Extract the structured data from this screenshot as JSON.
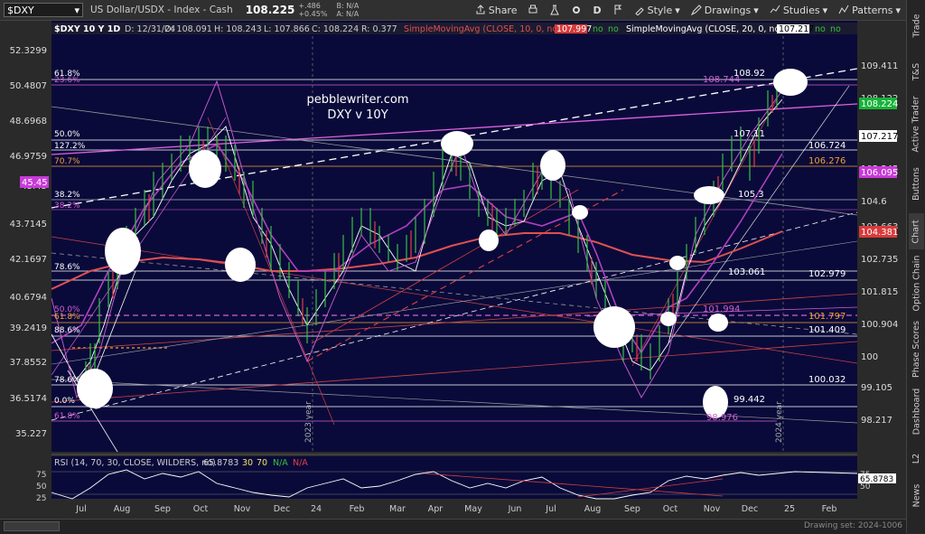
{
  "toolbar": {
    "symbol": "$DXY",
    "description": "US Dollar/USDX - Index - Cash",
    "price": "108.225",
    "change": "+.486",
    "change_pct": "+0.45%",
    "bid": "B: N/A",
    "ask": "A: N/A",
    "share": "Share",
    "period": "D",
    "style": "Style",
    "drawings": "Drawings",
    "studies": "Studies",
    "patterns": "Patterns"
  },
  "info": {
    "title": "$DXY 10 Y 1D",
    "date": "D: 12/31/24",
    "open": "O: 108.091",
    "high": "H: 108.243",
    "low": "L: 107.866",
    "close": "C: 108.224",
    "range": "R: 0.377",
    "sma10": "SimpleMovingAvg (CLOSE, 10, 0, no)",
    "sma10_val": "107.997",
    "sma20": "SimpleMovingAvg (CLOSE, 20, 0, no)",
    "sma20_val": "107.217",
    "no": "no"
  },
  "watermark": {
    "line1": "pebblewriter.com",
    "line2": "DXY v 10Y"
  },
  "price_axis": [
    "52.3299",
    "50.4807",
    "48.6968",
    "46.9759",
    "45.45",
    "43.7145",
    "42.1697",
    "40.6794",
    "39.2419",
    "37.8552",
    "36.5174",
    "35.227"
  ],
  "right_axis": [
    "109.411",
    "108.122",
    "106.499",
    "105.545",
    "104.6",
    "103.663",
    "102.735",
    "101.815",
    "100.904",
    "100",
    "99.105",
    "98.217"
  ],
  "tags": [
    {
      "t": "108.224",
      "c": "#17b33a",
      "fg": "#fff"
    },
    {
      "t": "107.217",
      "c": "#ffffff",
      "fg": "#000"
    },
    {
      "t": "106.095",
      "c": "#c83ad8",
      "fg": "#fff"
    },
    {
      "t": "104.381",
      "c": "#d93a3a",
      "fg": "#fff"
    },
    {
      "t": "45.45",
      "c": "#c83ad8",
      "fg": "#fff"
    }
  ],
  "fib_left": [
    "61.8%",
    "23.6%",
    "50.0%",
    "127.2%",
    "70.7%",
    "38.2%",
    "38.2%",
    "78.6%",
    "50.0%",
    "61.8%",
    "88.6%",
    "78.6%",
    "0.0%",
    "61.8%"
  ],
  "levels": [
    "108.92",
    "108.744",
    "107.11",
    "106.724",
    "106.276",
    "105.3",
    "103.061",
    "102.979",
    "101.994",
    "101.797",
    "101.409",
    "100.032",
    "99.442",
    "98.976"
  ],
  "vert_labels": [
    "2023 year",
    "2024 year"
  ],
  "months": [
    "Jul",
    "Aug",
    "Sep",
    "Oct",
    "Nov",
    "Dec",
    "24",
    "Feb",
    "Mar",
    "Apr",
    "May",
    "Jun",
    "Jul",
    "Aug",
    "Sep",
    "Oct",
    "Nov",
    "Dec",
    "25",
    "Feb"
  ],
  "rsi": {
    "label": "RSI (14, 70, 30, CLOSE, WILDERS, no)",
    "value": "65.8783",
    "ob": "30",
    "os": "70",
    "na1": "N/A",
    "na2": "N/A",
    "axis_top": "75",
    "axis_mid": "50",
    "axis_bot": "25"
  },
  "footer": "Drawing set: 2024-1006",
  "sidebar": [
    "Trade",
    "T&S",
    "Active Trader",
    "Buttons",
    "Chart",
    "Option Chain",
    "Phase Scores",
    "Dashboard",
    "L2",
    "News"
  ]
}
